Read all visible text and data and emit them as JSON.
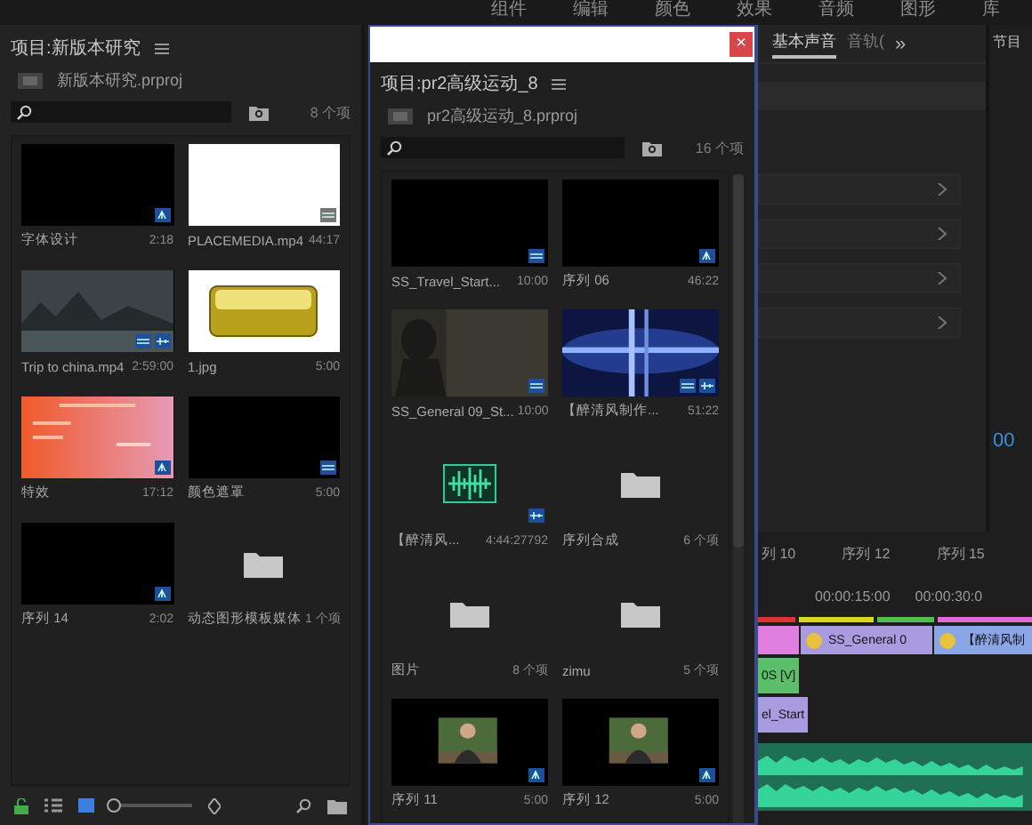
{
  "menu": [
    "组件",
    "编辑",
    "颜色",
    "效果",
    "音频",
    "图形",
    "库"
  ],
  "left_panel": {
    "title": "项目:新版本研究",
    "file": "新版本研究.prproj",
    "count": "8 个项",
    "zoom": {
      "level": 0.05
    },
    "view_modes": [
      {
        "kind": "list",
        "selected": false
      },
      {
        "kind": "icon",
        "selected": true
      }
    ],
    "items": [
      {
        "name": "字体设计",
        "info": "2:18",
        "kind": "black",
        "badges": [
          {
            "kind": "sequence"
          }
        ]
      },
      {
        "name": "PLACEMEDIA.mp4",
        "info": "44:17",
        "kind": "white",
        "badges": [
          {
            "kind": "offline"
          }
        ]
      },
      {
        "name": "Trip to china.mp4",
        "info": "2:59:00",
        "kind": "landscape",
        "badges": [
          {
            "kind": "video"
          },
          {
            "kind": "audio"
          }
        ]
      },
      {
        "name": "1.jpg",
        "info": "5:00",
        "kind": "button"
      },
      {
        "name": "特效",
        "info": "17:12",
        "kind": "gradient",
        "badges": [
          {
            "kind": "sequence"
          }
        ]
      },
      {
        "name": "颜色遮罩",
        "info": "5:00",
        "kind": "black",
        "badges": [
          {
            "kind": "video"
          }
        ]
      },
      {
        "name": "序列 14",
        "info": "2:02",
        "kind": "black",
        "badges": [
          {
            "kind": "sequence"
          }
        ]
      },
      {
        "name": "动态图形模板媒体",
        "info": "1 个项",
        "kind": "folder"
      }
    ]
  },
  "window": {
    "close": "×",
    "title": "项目:pr2高级运动_8",
    "file": "pr2高级运动_8.prproj",
    "count": "16 个项",
    "items": [
      {
        "name": "SS_Travel_Start...",
        "info": "10:00",
        "kind": "black",
        "badges": [
          {
            "kind": "video"
          }
        ]
      },
      {
        "name": "序列 06",
        "info": "46:22",
        "kind": "black",
        "badges": [
          {
            "kind": "sequence"
          }
        ]
      },
      {
        "name": "SS_General 09_St...",
        "info": "10:00",
        "kind": "dark",
        "badges": [
          {
            "kind": "video"
          }
        ]
      },
      {
        "name": "【醉清风制作...",
        "info": "51:22",
        "kind": "flare",
        "badges": [
          {
            "kind": "video"
          },
          {
            "kind": "audio"
          }
        ]
      },
      {
        "name": "【醉清风...",
        "info": "4:44:27792",
        "kind": "audio",
        "badges": [
          {
            "kind": "audio"
          }
        ]
      },
      {
        "name": "序列合成",
        "info": "6 个项",
        "kind": "folder"
      },
      {
        "name": "图片",
        "info": "8 个项",
        "kind": "folder"
      },
      {
        "name": "zimu",
        "info": "5 个项",
        "kind": "folder"
      },
      {
        "name": "序列 11",
        "info": "5:00",
        "kind": "person",
        "badges": [
          {
            "kind": "sequence"
          }
        ]
      },
      {
        "name": "序列 12",
        "info": "5:00",
        "kind": "person",
        "badges": [
          {
            "kind": "sequence"
          }
        ]
      }
    ]
  },
  "right_panel": {
    "tabs": [
      {
        "label": "基本声音",
        "selected": true
      },
      {
        "label": "音轨(",
        "selected": false
      }
    ],
    "more": "»",
    "program_tab": "节目",
    "timecode": "00",
    "sections": [
      {
        "expanded": false
      },
      {
        "expanded": false
      },
      {
        "expanded": false
      },
      {
        "expanded": false
      }
    ]
  },
  "timeline": {
    "sequences": [
      "列 10",
      "序列 12",
      "序列 15"
    ],
    "times": [
      "00:00:15:00",
      "00:00:30:0"
    ],
    "clips": [
      {
        "label": "SS_General 0",
        "color": "#a99be0"
      },
      {
        "label": "【醉清风制",
        "color": "#8aa6e6"
      }
    ],
    "v_clips": [
      {
        "label": "0S [V]",
        "color": "#5cc06a"
      },
      {
        "label": "el_Start",
        "color": "#a99be0"
      }
    ]
  }
}
